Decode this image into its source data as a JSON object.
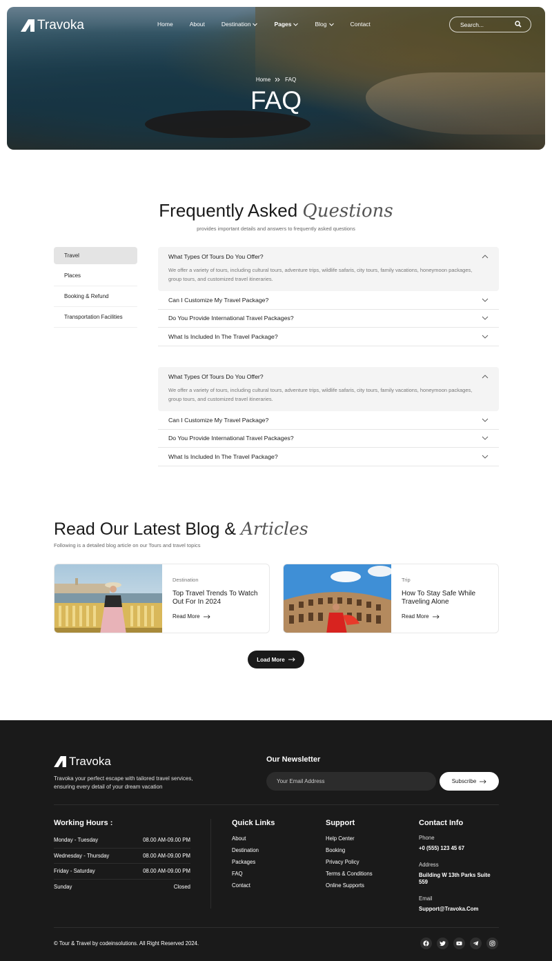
{
  "brand": {
    "name": "Travoka"
  },
  "nav": {
    "items": [
      {
        "label": "Home",
        "dropdown": false
      },
      {
        "label": "About",
        "dropdown": false
      },
      {
        "label": "Destination",
        "dropdown": true
      },
      {
        "label": "Pages",
        "dropdown": true
      },
      {
        "label": "Blog",
        "dropdown": true
      },
      {
        "label": "Contact",
        "dropdown": false
      }
    ],
    "search_placeholder": "Search..."
  },
  "hero": {
    "breadcrumb": {
      "home": "Home",
      "current": "FAQ"
    },
    "title": "FAQ"
  },
  "faq": {
    "heading": "Frequently Asked",
    "heading_script": "Questions",
    "subtitle": "provides important details and answers to frequently asked questions",
    "categories": [
      {
        "label": "Travel",
        "active": true
      },
      {
        "label": "Places",
        "active": false
      },
      {
        "label": "Booking & Refund",
        "active": false
      },
      {
        "label": "Transportation Facilities",
        "active": false
      }
    ],
    "groups": [
      {
        "open": {
          "question": "What Types Of Tours Do You Offer?",
          "answer": "We offer a variety of tours, including cultural tours, adventure trips, wildlife safaris, city tours, family vacations, honeymoon packages, group tours, and customized travel itineraries."
        },
        "closed": [
          "Can I Customize My Travel Package?",
          "Do You Provide International Travel Packages?",
          "What Is Included In The Travel Package?"
        ]
      },
      {
        "open": {
          "question": "What Types Of Tours Do You Offer?",
          "answer": "We offer a variety of tours, including cultural tours, adventure trips, wildlife safaris, city tours, family vacations, honeymoon packages, group tours, and customized travel itineraries."
        },
        "closed": [
          "Can I Customize My Travel Package?",
          "Do You Provide International Travel Packages?",
          "What Is Included In The Travel Package?"
        ]
      }
    ]
  },
  "blog": {
    "heading": "Read Our Latest Blog &",
    "heading_script": "Articles",
    "subtitle": "Following is a detailed blog article on our Tours and travel topics",
    "cards": [
      {
        "category": "Destination",
        "title": "Top Travel Trends To Watch Out For In 2024",
        "link": "Read More"
      },
      {
        "category": "Trip",
        "title": "How To Stay Safe While Traveling Alone",
        "link": "Read More"
      }
    ],
    "load_more": "Load More"
  },
  "footer": {
    "brand": "Travoka",
    "description": "Travoka your perfect escape with tailored travel services, ensuring every detail of your dream vacation",
    "newsletter": {
      "title": "Our Newsletter",
      "placeholder": "Your Email Address",
      "button": "Subscribe"
    },
    "hours": {
      "title": "Working Hours :",
      "rows": [
        {
          "day": "Monday - Tuesday",
          "time": "08.00 AM-09.00 PM"
        },
        {
          "day": "Wednesday - Thursday",
          "time": "08.00 AM-09.00 PM"
        },
        {
          "day": "Friday - Saturday",
          "time": "08.00 AM-09.00 PM"
        },
        {
          "day": "Sunday",
          "time": "Closed"
        }
      ]
    },
    "quick_links": {
      "title": "Quick Links",
      "items": [
        "About",
        "Destination",
        "Packages",
        "FAQ",
        "Contact"
      ]
    },
    "support": {
      "title": "Support",
      "items": [
        "Help Center",
        "Booking",
        "Privacy Policy",
        "Terms & Conditions",
        "Online Supports"
      ]
    },
    "contact": {
      "title": "Contact Info",
      "phone_label": "Phone",
      "phone": "+0 (555) 123 45 67",
      "address_label": "Address",
      "address": "Building W 13th Parks Suite 559",
      "email_label": "Email",
      "email": "Support@Travoka.Com"
    },
    "copyright": "© Tour & Travel by codeinsolutions. All Right Reserved 2024.",
    "socials": [
      "facebook-icon",
      "twitter-icon",
      "youtube-icon",
      "telegram-icon",
      "instagram-icon"
    ]
  }
}
